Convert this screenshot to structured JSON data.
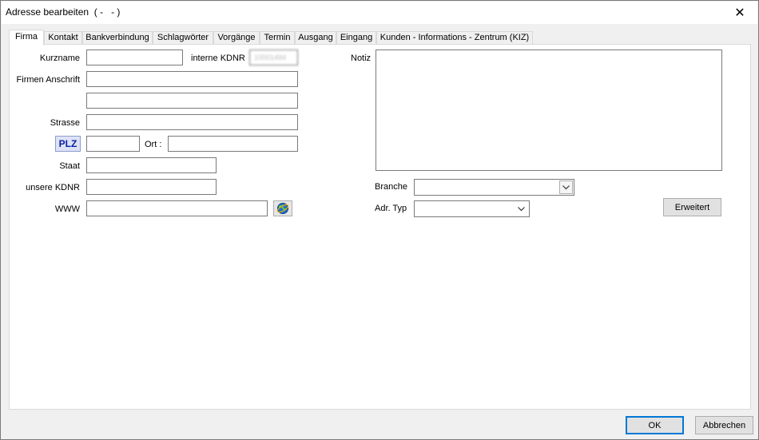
{
  "window": {
    "title": "Adresse bearbeiten  ( -   - )",
    "close_glyph": "✕"
  },
  "tabs": [
    {
      "label": "Firma",
      "active": true
    },
    {
      "label": "Kontakt"
    },
    {
      "label": "Bankverbindung"
    },
    {
      "label": "Schlagwörter"
    },
    {
      "label": "Vorgänge"
    },
    {
      "label": "Termin"
    },
    {
      "label": "Ausgang"
    },
    {
      "label": "Eingang"
    },
    {
      "label": "Kunden - Informations - Zentrum (KIZ)"
    }
  ],
  "form": {
    "kurzname_label": "Kurzname",
    "kurzname_value": "",
    "interne_kdnr_label": "interne KDNR",
    "interne_kdnr_value": "10001494",
    "firmen_anschrift_label": "Firmen Anschrift",
    "strasse_label": "Strasse",
    "plz_button": "PLZ",
    "ort_label": "Ort :",
    "staat_label": "Staat",
    "unsere_kdnr_label": "unsere KDNR",
    "www_label": "WWW",
    "notiz_label": "Notiz",
    "branche_label": "Branche",
    "adr_typ_label": "Adr. Typ",
    "erweitert_button": "Erweitert"
  },
  "footer": {
    "ok_button": "OK",
    "cancel_button": "Abbrechen"
  },
  "icons": {
    "close": "close-icon",
    "web": "globe-icon",
    "dropdown": "chevron-down-icon"
  }
}
